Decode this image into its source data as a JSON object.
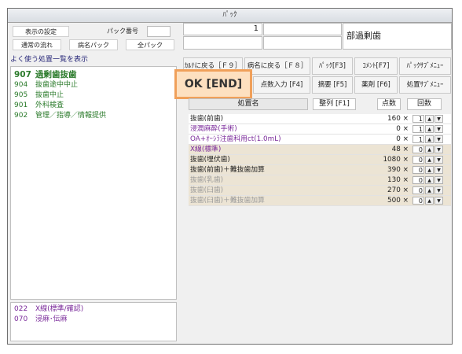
{
  "window": {
    "title": "ﾊﾟｯｸ"
  },
  "top_left": {
    "settings_label": "表示の設定",
    "pack_number_label": "パック番号",
    "normal_flow": "通常の流れ",
    "disease_pack": "病名パック",
    "all_pack": "全パック"
  },
  "top_right": {
    "count_value": "1",
    "region_label": "部過剰歯"
  },
  "favorites": {
    "header": "よく使う処置一覧を表示",
    "items": [
      {
        "code": "907",
        "label": "過剰歯抜歯",
        "style": "bold-green"
      },
      {
        "code": "904",
        "label": "抜歯途中中止",
        "style": "green"
      },
      {
        "code": "905",
        "label": "抜歯中止",
        "style": "green"
      },
      {
        "code": "901",
        "label": "外科検査",
        "style": "green"
      },
      {
        "code": "902",
        "label": "管理／指導／情報提供",
        "style": "green"
      }
    ],
    "bottom_items": [
      {
        "code": "022",
        "label": "X線(標準/確認)"
      },
      {
        "code": "070",
        "label": "浸麻･伝麻"
      }
    ]
  },
  "menu": {
    "back_karte": "ｶﾙﾃに戻る［Ｆ９］",
    "back_disease": "病名に戻る［Ｆ８］",
    "pack": "ﾊﾟｯｸ[F3]",
    "comment": "ｺﾒﾝﾄ[F7]",
    "pack_submenu": "ﾊﾟｯｸｻﾌﾞﾒﾆｭｰ",
    "ok": "OK [END]",
    "points_input": "点数入力 [F4]",
    "summary": "摘要 [F5]",
    "medicine": "薬剤 [F6]",
    "treatment_submenu": "処置ｻﾌﾞﾒﾆｭｰ"
  },
  "grid": {
    "col_name": "処置名",
    "sort": "整列 [F1]",
    "points": "点数",
    "times": "回数",
    "rows": [
      {
        "name": "抜歯(前歯)",
        "points": "160",
        "qty": "1",
        "color": "black",
        "bg": "white"
      },
      {
        "name": "浸潤麻酔(手術)",
        "points": "0",
        "qty": "1",
        "color": "purple",
        "bg": "white"
      },
      {
        "name": "OA+ｵｰｼﾗ注歯科用ct(1.0mL)",
        "points": "0",
        "qty": "1",
        "color": "purple",
        "bg": "white"
      },
      {
        "name": "X線(標準)",
        "points": "48",
        "qty": "0",
        "color": "purple",
        "bg": "tan"
      },
      {
        "name": "抜歯(埋伏歯)",
        "points": "1080",
        "qty": "0",
        "color": "black",
        "bg": "tan"
      },
      {
        "name": "抜歯(前歯)＋難抜歯加算",
        "points": "390",
        "qty": "0",
        "color": "black",
        "bg": "tan"
      },
      {
        "name": "抜歯(乳歯)",
        "points": "130",
        "qty": "0",
        "color": "gray",
        "bg": "tan"
      },
      {
        "name": "抜歯(臼歯)",
        "points": "270",
        "qty": "0",
        "color": "gray",
        "bg": "tan"
      },
      {
        "name": "抜歯(臼歯)＋難抜歯加算",
        "points": "500",
        "qty": "0",
        "color": "gray",
        "bg": "tan"
      }
    ],
    "times_symbol": "×"
  },
  "colors": {
    "ok_border": "#f0a05a",
    "ok_fill": "#fde0c0",
    "tan_row": "#ece4d4",
    "green_text": "#2a7a2a",
    "purple_text": "#7a2a9a"
  }
}
